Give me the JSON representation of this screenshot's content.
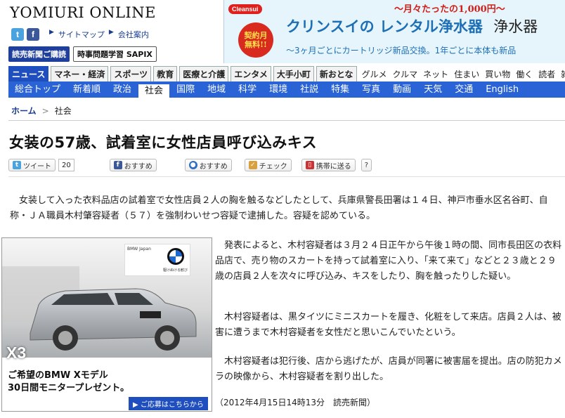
{
  "header": {
    "logo": "YOMIURI ONLINE",
    "links": [
      "サイトマップ",
      "会社案内"
    ],
    "buttons": [
      "読売新聞ご購読",
      "時事問題学習 SAPIX"
    ]
  },
  "banner": {
    "brand": "Cleansui",
    "offer": "〜月々たったの1,000円〜",
    "badge": "契約月\n無料!!",
    "headline_a": "クリンスイの",
    "headline_b": "レンタル浄水器",
    "headline_c": "浄水器",
    "sub": "〜3ヶ月ごとにカートリッジ新品交換。1年ごとに本体も新品"
  },
  "categories": {
    "tabs": [
      "ニュース",
      "マネー・経済",
      "スポーツ",
      "教育",
      "医療と介護",
      "エンタメ",
      "大手小町",
      "新おとな"
    ],
    "plain": [
      "グルメ",
      "クルマ",
      "ネット",
      "住まい",
      "買い物",
      "働く",
      "読者",
      "雑誌",
      "選"
    ]
  },
  "subnav": {
    "items": [
      "総合トップ",
      "新着順",
      "政治",
      "社会",
      "国際",
      "地域",
      "科学",
      "環境",
      "社説",
      "特集",
      "写真",
      "動画",
      "天気",
      "交通",
      "English"
    ],
    "active_index": 3
  },
  "breadcrumb": {
    "home": "ホーム",
    "sep": ">",
    "current": "社会"
  },
  "article": {
    "title": "女装の57歳、試着室に女性店員呼び込みキス",
    "share": {
      "tweet": "ツイート",
      "tweet_count": "20",
      "fb": "おすすめ",
      "mixi": "おすすめ",
      "check": "チェック",
      "mobile": "携帯に送る",
      "help": "?"
    },
    "p1": "女装して入った衣料品店の試着室で女性店員２人の胸を触るなどしたとして、兵庫県警長田署は１４日、神戸市垂水区名谷町、自称・ＪＡ職員木村肇容疑者（５７）を強制わいせつ容疑で逮捕した。容疑を認めている。",
    "p2": "発表によると、木村容疑者は３月２４日正午から午後１時の間、同市長田区の衣料品店で、売り物のスカートを持って試着室に入り、「来て来て」などと２３歳と２９歳の店員２人を次々に呼び込み、キスをしたり、胸を触ったりした疑い。",
    "p3": "木村容疑者は、黒タイツにミニスカートを履き、化粧をして来店。店員２人は、被害に遭うまで木村容疑者を女性だと思いこんでいたという。",
    "p4": "木村容疑者は犯行後、店から逃げたが、店員が同署に被害届を提出。店の防犯カメラの映像から、木村容疑者を割り出した。",
    "dateline": "（2012年4月15日14時13分　読売新聞）"
  },
  "ad": {
    "brand_text": "BMW Japan",
    "tagline": "駆けぬける歓び",
    "model": "X3",
    "copy1": "ご希望のBMW Xモデル",
    "copy2": "30日間モニタープレゼント。",
    "cta": "▶ ご応募はこちらから"
  }
}
